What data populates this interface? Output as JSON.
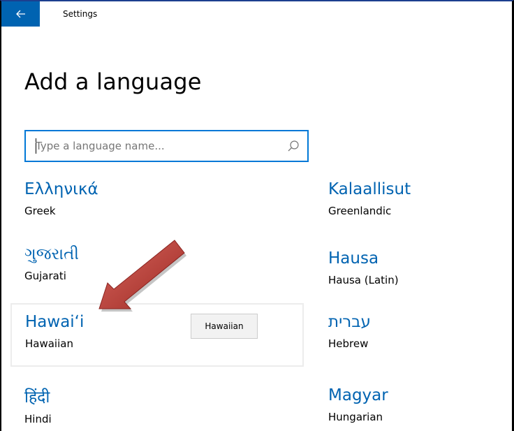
{
  "window": {
    "title": "Settings",
    "accent_color": "#0063b1",
    "back_icon": "back-arrow-icon"
  },
  "page": {
    "title": "Add a language"
  },
  "search": {
    "value": "",
    "placeholder": "Type a language name...",
    "icon": "search-icon",
    "border_color": "#0078d7"
  },
  "languages": [
    {
      "native": "Ελληνικά",
      "english": "Greek"
    },
    {
      "native": "Kalaallisut",
      "english": "Greenlandic"
    },
    {
      "native": "ગુજરાતી",
      "english": "Gujarati"
    },
    {
      "native": "Hausa",
      "english": "Hausa (Latin)"
    },
    {
      "native": "Hawaiʻi",
      "english": "Hawaiian",
      "hovered": true
    },
    {
      "native": "עברית",
      "english": "Hebrew"
    },
    {
      "native": "हिंदी",
      "english": "Hindi"
    },
    {
      "native": "Magyar",
      "english": "Hungarian"
    }
  ],
  "tooltip": {
    "text": "Hawaiian"
  },
  "annotation": {
    "type": "arrow",
    "color": "#b0302b",
    "points_to": "Hawaiian"
  }
}
